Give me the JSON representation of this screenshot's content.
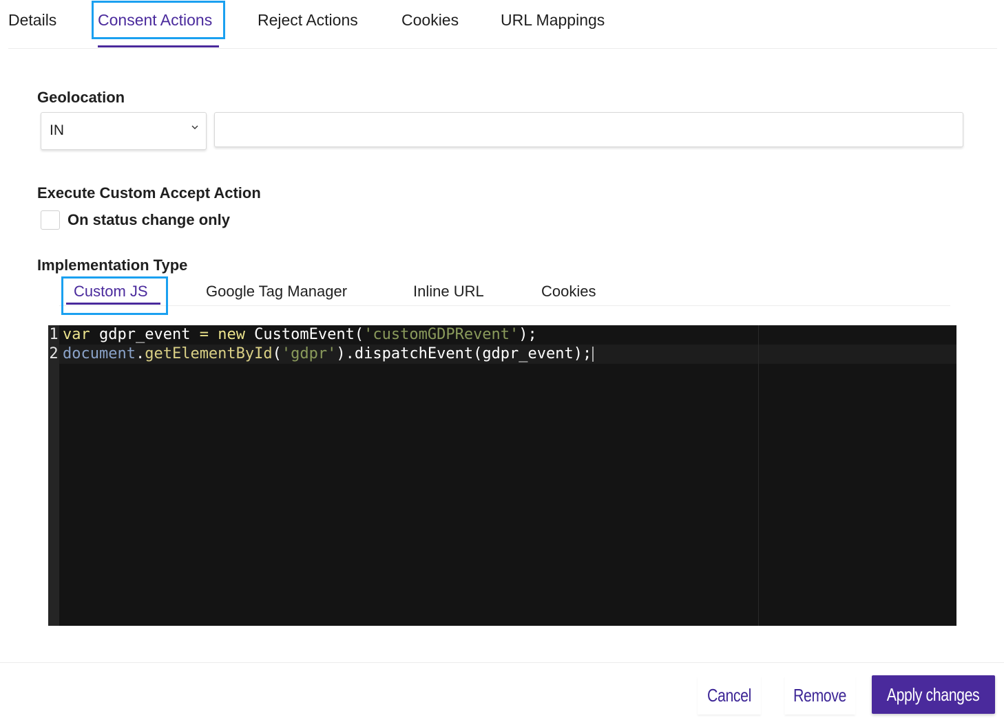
{
  "top_tabs": {
    "items": [
      "Details",
      "Consent Actions",
      "Reject Actions",
      "Cookies",
      "URL Mappings"
    ],
    "active": "Consent Actions"
  },
  "geolocation": {
    "label": "Geolocation",
    "selected": "IN",
    "input_value": ""
  },
  "custom_accept": {
    "label": "Execute Custom Accept Action",
    "checkbox_label": "On status change only",
    "checked": false
  },
  "implementation": {
    "label": "Implementation Type",
    "tabs": [
      "Custom JS",
      "Google Tag Manager",
      "Inline URL",
      "Cookies"
    ],
    "active": "Custom JS"
  },
  "editor": {
    "line_numbers": [
      "1",
      "2"
    ],
    "lines": [
      "var gdpr_event = new CustomEvent('customGDPRevent');",
      "document.getElementById('gdpr').dispatchEvent(gdpr_event);"
    ],
    "tokens": {
      "l1_var": "var",
      "l1_name": " gdpr_event ",
      "l1_eq": "=",
      "l1_new": " new",
      "l1_ctor": " CustomEvent(",
      "l1_str": "'customGDPRevent'",
      "l1_end": ");",
      "l2_doc": "document",
      "l2_dot": ".",
      "l2_fn": "getElementById",
      "l2_open": "(",
      "l2_str": "'gdpr'",
      "l2_rest": ").dispatchEvent(gdpr_event);"
    }
  },
  "footer": {
    "cancel_label": "Cancel",
    "remove_label": "Remove",
    "apply_label": "Apply changes"
  },
  "colors": {
    "accent": "#4a2a9c",
    "focus_ring": "#1aa0f0",
    "editor_bg": "#141414"
  }
}
